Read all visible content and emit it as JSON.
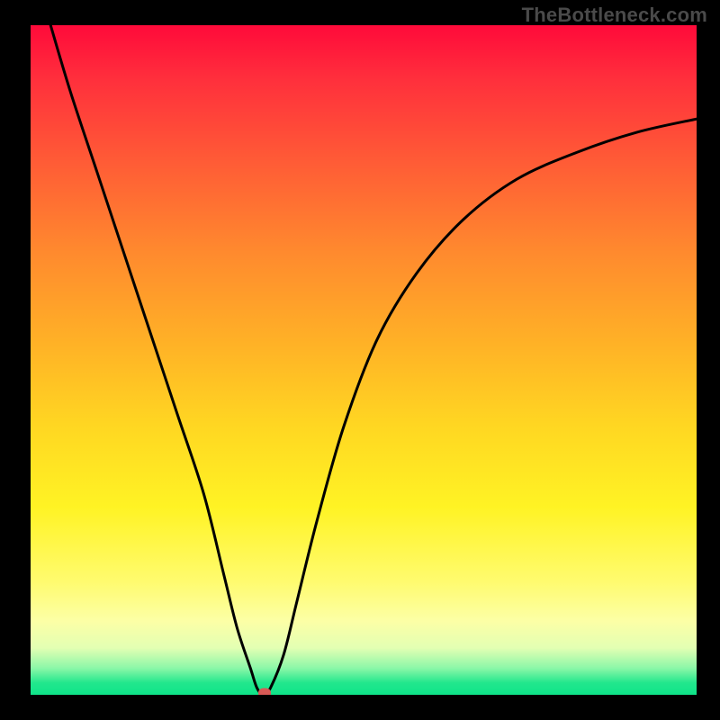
{
  "watermark": "TheBottleneck.com",
  "chart_data": {
    "type": "line",
    "title": "",
    "xlabel": "",
    "ylabel": "",
    "xlim": [
      0,
      100
    ],
    "ylim": [
      0,
      100
    ],
    "grid": false,
    "series": [
      {
        "name": "curve",
        "x": [
          3,
          6,
          10,
          14,
          18,
          22,
          26,
          29,
          31,
          33,
          34,
          35,
          36,
          38,
          40,
          43,
          47,
          52,
          58,
          65,
          73,
          82,
          91,
          100
        ],
        "values": [
          100,
          90,
          78,
          66,
          54,
          42,
          30,
          18,
          10,
          4,
          1,
          0,
          1,
          6,
          14,
          26,
          40,
          53,
          63,
          71,
          77,
          81,
          84,
          86
        ]
      }
    ],
    "marker": {
      "x": 35.2,
      "y": 0.3
    },
    "colors": {
      "curve": "#000000",
      "marker": "#d85a56",
      "gradient_top": "#ff0a3a",
      "gradient_bottom": "#0fe489",
      "frame": "#000000"
    }
  }
}
